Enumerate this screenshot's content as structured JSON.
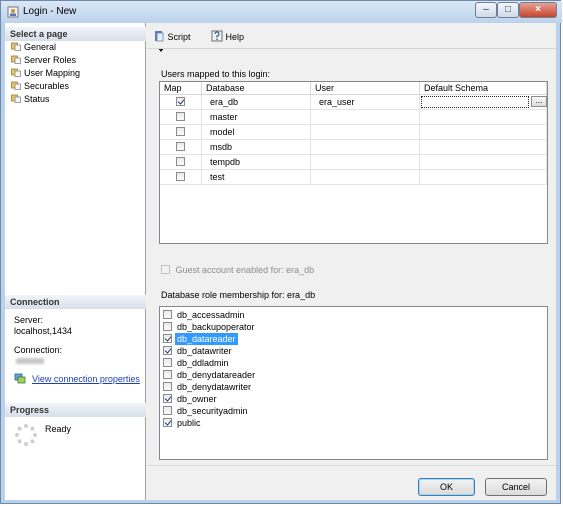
{
  "window": {
    "title": "Login - New",
    "minimize": "–",
    "maximize": "□",
    "close": "×"
  },
  "left": {
    "select_page_header": "Select a page",
    "pages": [
      "General",
      "Server Roles",
      "User Mapping",
      "Securables",
      "Status"
    ],
    "connection_header": "Connection",
    "server_label": "Server:",
    "server_value": "localhost,1434",
    "connection_label": "Connection:",
    "view_connection_link": "View connection properties",
    "progress_header": "Progress",
    "progress_status": "Ready"
  },
  "toolbar": {
    "script_label": "Script",
    "help_label": "Help"
  },
  "users_mapped": {
    "label": "Users mapped to this login:",
    "columns": [
      "Map",
      "Database",
      "User",
      "Default Schema"
    ],
    "rows": [
      {
        "map": true,
        "database": "era_db",
        "user": "era_user",
        "schema": ""
      },
      {
        "map": false,
        "database": "master",
        "user": "",
        "schema": ""
      },
      {
        "map": false,
        "database": "model",
        "user": "",
        "schema": ""
      },
      {
        "map": false,
        "database": "msdb",
        "user": "",
        "schema": ""
      },
      {
        "map": false,
        "database": "tempdb",
        "user": "",
        "schema": ""
      },
      {
        "map": false,
        "database": "test",
        "user": "",
        "schema": ""
      }
    ],
    "ellipsis": "..."
  },
  "guest": {
    "label": "Guest account enabled for: era_db",
    "checked": false
  },
  "roles": {
    "label": "Database role membership for: era_db",
    "items": [
      {
        "name": "db_accessadmin",
        "checked": false
      },
      {
        "name": "db_backupoperator",
        "checked": false
      },
      {
        "name": "db_datareader",
        "checked": true,
        "selected": true
      },
      {
        "name": "db_datawriter",
        "checked": true
      },
      {
        "name": "db_ddladmin",
        "checked": false
      },
      {
        "name": "db_denydatareader",
        "checked": false
      },
      {
        "name": "db_denydatawriter",
        "checked": false
      },
      {
        "name": "db_owner",
        "checked": true
      },
      {
        "name": "db_securityadmin",
        "checked": false
      },
      {
        "name": "public",
        "checked": true
      }
    ]
  },
  "buttons": {
    "ok": "OK",
    "cancel": "Cancel"
  }
}
